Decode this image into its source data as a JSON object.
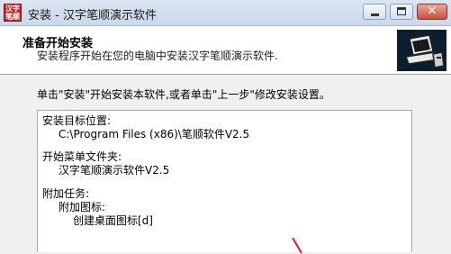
{
  "window": {
    "title": "安装 - 汉字笔顺演示软件",
    "icon_text": [
      "汉字",
      "笔顺"
    ],
    "controls": {
      "minimize_icon": "minimize-icon",
      "maximize_icon": "maximize-icon",
      "close_glyph": "✕"
    }
  },
  "header": {
    "title": "准备开始安装",
    "subtitle": "安装程序开始在您的电脑中安装汉字笔顺演示软件."
  },
  "body": {
    "instruction": "单击\"安装\"开始安装本软件,或者单击\"上一步\"修改安装设置。",
    "summary_lines": [
      "安装目标位置:",
      "C:\\Program Files (x86)\\笔顺软件V2.5",
      "开始菜单文件夹:",
      "汉字笔顺演示软件V2.5",
      "附加任务:",
      "附加图标:",
      "创建桌面图标[d]"
    ]
  },
  "colors": {
    "titlebar": "#c9d8ea",
    "close_button": "#c8503a",
    "header_bg": "#ffffff",
    "dialog_bg": "#f0f0f0",
    "logo_bg": "#0b1f2e"
  }
}
